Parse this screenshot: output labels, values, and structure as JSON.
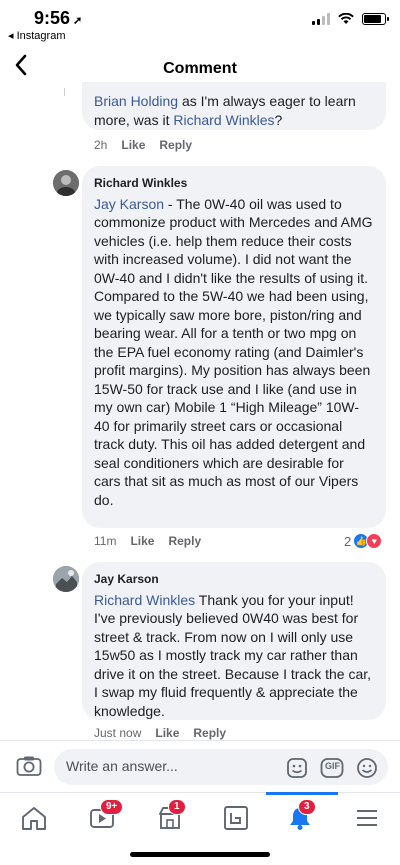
{
  "status_bar": {
    "time": "9:56",
    "back_app": "◂ Instagram"
  },
  "header": {
    "back_icon": "chevron-left-icon",
    "title": "Comment"
  },
  "comments": [
    {
      "author": "",
      "mention": "Brian Holding",
      "text_before": " as I'm always eager to learn more, was it ",
      "mention2": "Richard Winkles",
      "text_after": "?",
      "time": "2h",
      "like": "Like",
      "reply": "Reply"
    },
    {
      "author": "Richard Winkles",
      "mention": "Jay Karson",
      "text": " - The 0W-40 oil was used to commonize  product with Mercedes and AMG vehicles (i.e. help them reduce their costs with increased volume). I did not want the 0W-40 and I didn't like the results of using it. Compared to the 5W-40 we had been using, we typically saw more bore, piston/ring and bearing wear. All for a tenth or two mpg on the EPA fuel economy rating (and Daimler's profit margins). My position has always been 15W-50 for track use and I like (and use in my own car) Mobile 1 “High Mileage” 10W-40 for primarily street cars or occasional track duty. This oil has added detergent and seal conditioners which are desirable for cars that sit as much as most of our Vipers do.",
      "time": "11m",
      "like": "Like",
      "reply": "Reply",
      "reaction_count": "2"
    },
    {
      "author": "Jay Karson",
      "mention": "Richard Winkles",
      "text": " Thank you for your input! I've previously believed 0W40 was best for street & track.  From now on I will only use 15w50 as I mostly track my car rather than drive it on the street. Because I track the car, I swap my fluid frequently & appreciate the knowledge.",
      "time": "Just now",
      "like": "Like",
      "reply": "Reply"
    }
  ],
  "composer": {
    "placeholder": "Write an answer...",
    "gif_label": "GIF"
  },
  "tabbar": {
    "video_badge": "9+",
    "marketplace_badge": "1",
    "notifications_badge": "3"
  },
  "colors": {
    "mention": "#3b5998",
    "bubble": "#f0f2f5",
    "accent": "#1877f2",
    "badge": "#e41e3f"
  }
}
